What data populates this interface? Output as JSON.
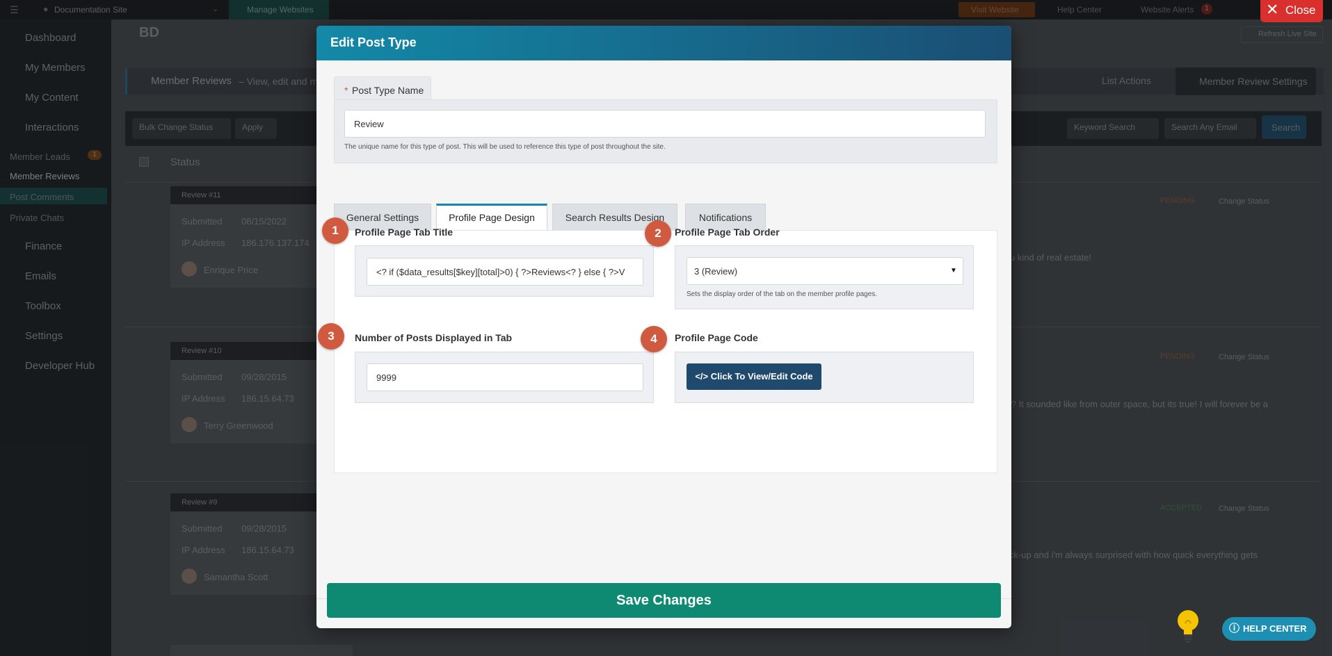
{
  "topbar": {
    "site_selector": "Documentation Site",
    "manage_websites": "Manage Websites",
    "visit_website": "Visit Website",
    "help_center": "Help Center",
    "website_alerts": "Website Alerts",
    "alerts_count": "1"
  },
  "sidebar": {
    "items": [
      {
        "label": "Dashboard",
        "icon": "dashboard-icon"
      },
      {
        "label": "My Members",
        "icon": "members-icon"
      },
      {
        "label": "My Content",
        "icon": "content-icon"
      },
      {
        "label": "Interactions",
        "icon": "chat-icon"
      }
    ],
    "subitems": [
      "Member Leads",
      "Member Reviews",
      "Post Comments",
      "Private Chats"
    ],
    "member_leads_count": "1",
    "items_lower": [
      {
        "label": "Finance"
      },
      {
        "label": "Emails"
      },
      {
        "label": "Toolbox"
      },
      {
        "label": "Settings"
      },
      {
        "label": "Developer Hub"
      }
    ]
  },
  "background": {
    "page_title": "Member Reviews",
    "page_subtitle": "– View, edit and m",
    "list_actions": "List Actions",
    "review_settings": "Member Review Settings",
    "refresh": "Refresh Live Site",
    "bulk_change": "Bulk Change Status",
    "apply": "Apply",
    "keyword_search": "Keyword Search",
    "email_search": "Search Any Email",
    "search": "Search",
    "status_header": "Status",
    "change_status": "Change Status",
    "reviews": [
      {
        "id": "Review #11",
        "submitted": "08/15/2022",
        "ip": "186.176.137.174",
        "name": "Enrique Price",
        "status": "PENDING",
        "snippet": "u kind of real estate!"
      },
      {
        "id": "Review #10",
        "submitted": "09/28/2015",
        "ip": "186.15.64.73",
        "name": "Terry Greenwood",
        "status": "PENDING",
        "snippet": "ce? It sounded like from outer space, but its true! I will forever be a"
      },
      {
        "id": "Review #9",
        "submitted": "09/28/2015",
        "ip": "186.15.64.73",
        "name": "Samantha Scott",
        "status": "ACCEPTED",
        "snippet": "ick-up and i'm always surprised with how quick everything gets"
      }
    ],
    "submitted_label": "Submitted",
    "ip_label": "IP Address"
  },
  "modal": {
    "title": "Edit Post Type",
    "post_type_name_label": "Post Type Name",
    "required_marker": "*",
    "post_type_name_value": "Review",
    "post_type_name_help": "The unique name for this type of post. This will be used to reference this type of post throughout the site.",
    "tabs": [
      "General Settings",
      "Profile Page Design",
      "Search Results Design",
      "Notifications"
    ],
    "active_tab": "Profile Page Design",
    "fields": {
      "tab_title": {
        "badge": "1",
        "label": "Profile Page Tab Title",
        "value": "<? if ($data_results[$key][total]>0) { ?>Reviews<? } else { ?>V"
      },
      "tab_order": {
        "badge": "2",
        "label": "Profile Page Tab Order",
        "value": "3 (Review)",
        "help": "Sets the display order of the tab on the member profile pages."
      },
      "posts_displayed": {
        "badge": "3",
        "label": "Number of Posts Displayed in Tab",
        "value": "9999"
      },
      "page_code": {
        "badge": "4",
        "label": "Profile Page Code",
        "button": "Click To View/Edit Code"
      }
    },
    "save_button": "Save Changes"
  },
  "close_button": "Close",
  "help_center_button": "HELP CENTER"
}
